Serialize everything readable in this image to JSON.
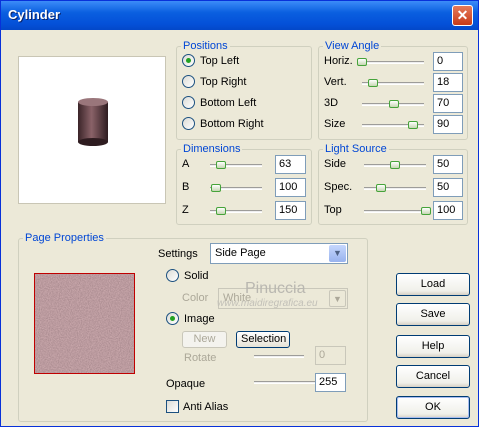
{
  "window": {
    "title": "Cylinder",
    "close": "✕"
  },
  "positions": {
    "legend": "Positions",
    "items": [
      {
        "label": "Top Left",
        "selected": true
      },
      {
        "label": "Top Right",
        "selected": false
      },
      {
        "label": "Bottom Left",
        "selected": false
      },
      {
        "label": "Bottom Right",
        "selected": false
      }
    ]
  },
  "view_angle": {
    "legend": "View Angle",
    "rows": [
      {
        "label": "Horiz.",
        "value": "0",
        "level": 0.0
      },
      {
        "label": "Vert.",
        "value": "18",
        "level": 0.18
      },
      {
        "label": "3D",
        "value": "70",
        "level": 0.52
      },
      {
        "label": "Size",
        "value": "90",
        "level": 0.82
      }
    ]
  },
  "dimensions": {
    "legend": "Dimensions",
    "rows": [
      {
        "label": "A",
        "value": "63",
        "level": 0.22
      },
      {
        "label": "B",
        "value": "100",
        "level": 0.12
      },
      {
        "label": "Z",
        "value": "150",
        "level": 0.22
      }
    ]
  },
  "light_source": {
    "legend": "Light Source",
    "rows": [
      {
        "label": "Side",
        "value": "50",
        "level": 0.5
      },
      {
        "label": "Spec.",
        "value": "50",
        "level": 0.28
      },
      {
        "label": "Top",
        "value": "100",
        "level": 1.0
      }
    ]
  },
  "page_properties": {
    "legend": "Page Properties",
    "settings_label": "Settings",
    "settings_value": "Side Page",
    "solid_label": "Solid",
    "color_label": "Color",
    "color_value": "White",
    "image_label": "Image",
    "new_label": "New",
    "selection_label": "Selection",
    "rotate_label": "Rotate",
    "rotate_value": "0",
    "opaque_label": "Opaque",
    "opaque_value": "255",
    "opaque_level": 1.0,
    "anti_alias_label": "Anti Alias"
  },
  "buttons": {
    "load": "Load",
    "save": "Save",
    "help": "Help",
    "cancel": "Cancel",
    "ok": "OK"
  },
  "watermark": {
    "name": "Pinuccia",
    "url": "www.maidiregrafica.eu"
  }
}
